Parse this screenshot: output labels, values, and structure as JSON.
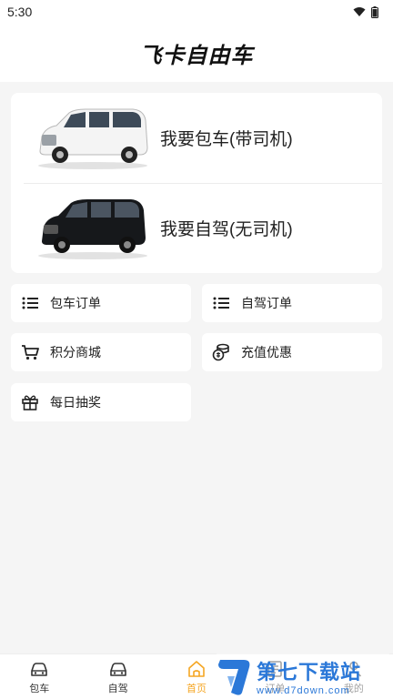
{
  "status": {
    "time": "5:30"
  },
  "header": {
    "title": "飞卡自由车"
  },
  "hero": {
    "items": [
      {
        "label": "我要包车(带司机)"
      },
      {
        "label": "我要自驾(无司机)"
      }
    ]
  },
  "tiles": [
    {
      "label": "包车订单",
      "icon": "list-icon"
    },
    {
      "label": "自驾订单",
      "icon": "list-icon"
    },
    {
      "label": "积分商城",
      "icon": "cart-icon"
    },
    {
      "label": "充值优惠",
      "icon": "coins-icon"
    },
    {
      "label": "每日抽奖",
      "icon": "gift-icon"
    }
  ],
  "tabbar": {
    "items": [
      {
        "label": "包车",
        "icon": "car-icon"
      },
      {
        "label": "自驾",
        "icon": "car-icon"
      },
      {
        "label": "首页",
        "icon": "home-icon",
        "active": true
      },
      {
        "label": "订单",
        "icon": "order-icon"
      },
      {
        "label": "我的",
        "icon": "user-icon"
      }
    ]
  },
  "watermark": {
    "title": "第七下载站",
    "url": "www.d7down.com"
  },
  "colors": {
    "accent": "#f5a623",
    "watermark": "#2b78d8"
  }
}
